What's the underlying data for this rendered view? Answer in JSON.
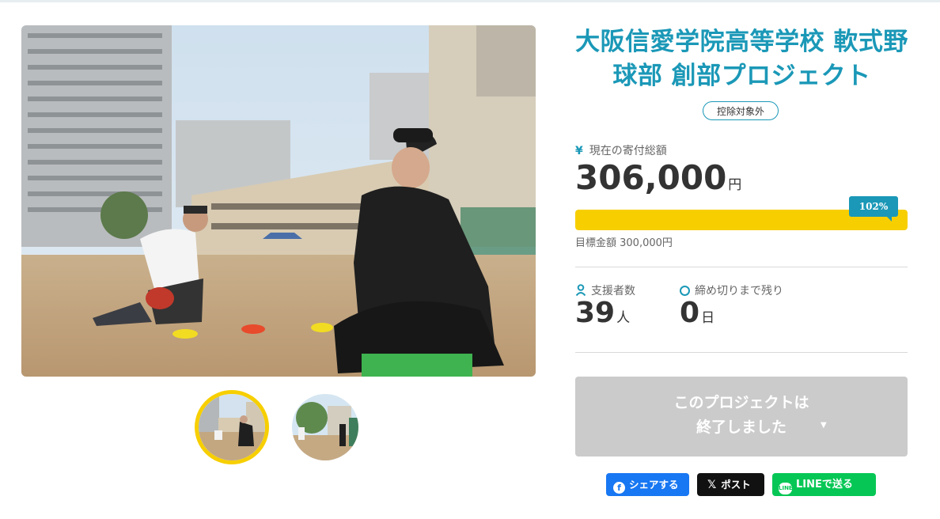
{
  "project": {
    "title": "大阪信愛学院高等学校 軟式野球部 創部プロジェクト",
    "badge": "控除対象外"
  },
  "funding": {
    "current_label": "現在の寄付総額",
    "current_icon": "yen-icon",
    "current_amount": "306,000",
    "currency_unit": "円",
    "percent": "102%",
    "progress_fraction": 1.0,
    "goal_text": "目標金額 300,000円"
  },
  "supporters": {
    "label": "支援者数",
    "icon": "person-icon",
    "count": "39",
    "unit": "人"
  },
  "deadline": {
    "label": "締め切りまで残り",
    "icon": "clock-icon",
    "days": "0",
    "unit": "日"
  },
  "status_button": {
    "line1": "このプロジェクトは",
    "line2": "終了しました",
    "arrow": "▼"
  },
  "share": {
    "facebook": "シェアする",
    "x": "ポスト",
    "line": "LINEで送る"
  },
  "colors": {
    "accent": "#1b98b7",
    "progress": "#f7cf00",
    "ended_button": "#cbcbcb",
    "facebook": "#1877f2",
    "x": "#111111",
    "line": "#06c755"
  }
}
